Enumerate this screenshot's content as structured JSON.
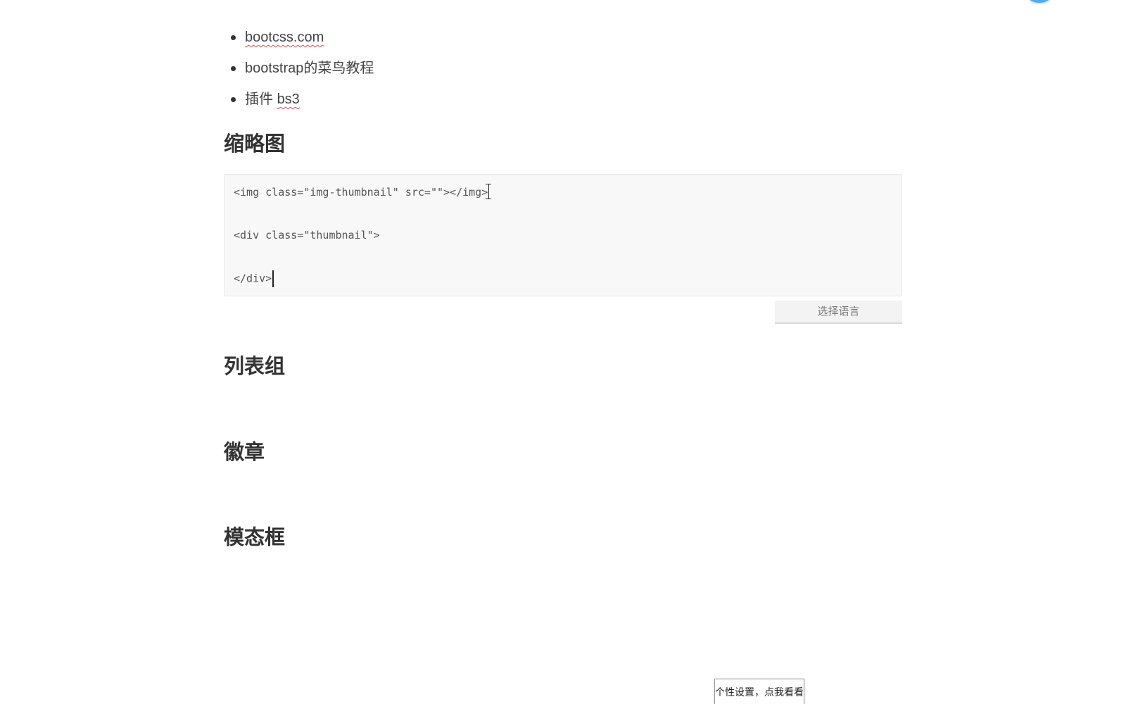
{
  "links": [
    {
      "text": "bootcss.com"
    },
    {
      "text": "bootstrap的菜鸟教程"
    },
    {
      "prefix": "插件 ",
      "text": "bs3"
    }
  ],
  "sections": {
    "thumbnail": "缩略图",
    "list_group": "列表组",
    "badge": "徽章",
    "modal": "模态框"
  },
  "code_block": {
    "lines": [
      "<img class=\"img-thumbnail\" src=\"\"></img> ",
      "<div class=\"thumbnail\">",
      "</div>"
    ]
  },
  "language_select": {
    "label": "选择语言"
  },
  "settings_tip": {
    "label": "个性设置，点我看看"
  }
}
